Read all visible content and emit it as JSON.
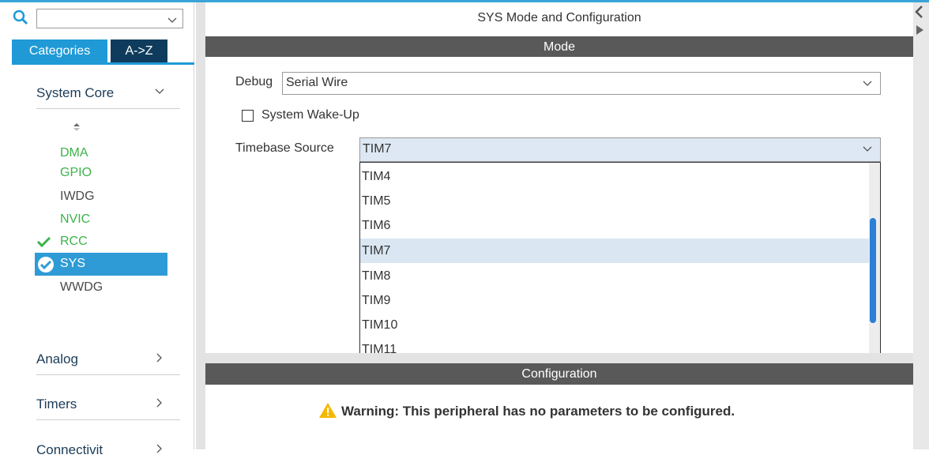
{
  "search": {
    "value": "",
    "placeholder": ""
  },
  "tabs": {
    "categories": "Categories",
    "az": "A->Z"
  },
  "categories": [
    {
      "label": "System Core",
      "expanded": true
    },
    {
      "label": "Analog",
      "expanded": false
    },
    {
      "label": "Timers",
      "expanded": false
    },
    {
      "label": "Connectivit",
      "expanded": false
    }
  ],
  "system_core_items": [
    {
      "label": "DMA",
      "color": "#3cb34a"
    },
    {
      "label": "GPIO",
      "color": "#3cb34a"
    },
    {
      "label": "IWDG",
      "color": "#4a4a4a"
    },
    {
      "label": "NVIC",
      "color": "#3cb34a"
    },
    {
      "label": "RCC",
      "color": "#3cb34a",
      "status": "check-icon"
    },
    {
      "label": "SYS",
      "color": "#ffffff",
      "status": "check-circle-icon",
      "selected": true
    },
    {
      "label": "WWDG",
      "color": "#4a4a4a"
    }
  ],
  "panel": {
    "title": "SYS Mode and Configuration",
    "mode_header": "Mode",
    "config_header": "Configuration",
    "debug_label": "Debug",
    "debug_value": "Serial Wire",
    "wakeup_label": "System Wake-Up",
    "wakeup_checked": false,
    "timebase_label": "Timebase Source",
    "timebase_value": "TIM7",
    "warning": "Warning: This peripheral has no parameters to be configured."
  },
  "timebase_options": [
    "TIM4",
    "TIM5",
    "TIM6",
    "TIM7",
    "TIM8",
    "TIM9",
    "TIM10",
    "TIM11"
  ],
  "timebase_selected": "TIM7",
  "colors": {
    "accent": "#1f9ad6",
    "dark_tab": "#0f3c5c",
    "header_bar": "#595959",
    "selection": "#2f9bd6",
    "ok_green": "#3cb34a",
    "warning": "#f5b800"
  }
}
